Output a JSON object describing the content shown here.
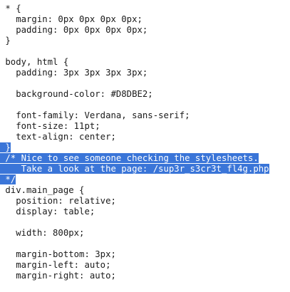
{
  "code": {
    "lines": [
      {
        "text": " * {",
        "selected": false
      },
      {
        "text": "   margin: 0px 0px 0px 0px;",
        "selected": false
      },
      {
        "text": "   padding: 0px 0px 0px 0px;",
        "selected": false
      },
      {
        "text": " }",
        "selected": false
      },
      {
        "text": "",
        "selected": false
      },
      {
        "text": " body, html {",
        "selected": false
      },
      {
        "text": "   padding: 3px 3px 3px 3px;",
        "selected": false
      },
      {
        "text": "",
        "selected": false
      },
      {
        "text": "   background-color: #D8DBE2;",
        "selected": false
      },
      {
        "text": "",
        "selected": false
      },
      {
        "text": "   font-family: Verdana, sans-serif;",
        "selected": false
      },
      {
        "text": "   font-size: 11pt;",
        "selected": false
      },
      {
        "text": "   text-align: center;",
        "selected": false
      },
      {
        "text": " }",
        "selected": true
      },
      {
        "text": " /* Nice to see someone checking the stylesheets.",
        "selected": true
      },
      {
        "text": "    Take a look at the page: /sup3r_s3cr3t_fl4g.php",
        "selected": true
      },
      {
        "text": " */",
        "selected": true
      },
      {
        "text": " div.main_page {",
        "selected": false
      },
      {
        "text": "   position: relative;",
        "selected": false
      },
      {
        "text": "   display: table;",
        "selected": false
      },
      {
        "text": "",
        "selected": false
      },
      {
        "text": "   width: 800px;",
        "selected": false
      },
      {
        "text": "",
        "selected": false
      },
      {
        "text": "   margin-bottom: 3px;",
        "selected": false
      },
      {
        "text": "   margin-left: auto;",
        "selected": false
      },
      {
        "text": "   margin-right: auto;",
        "selected": false
      }
    ]
  }
}
